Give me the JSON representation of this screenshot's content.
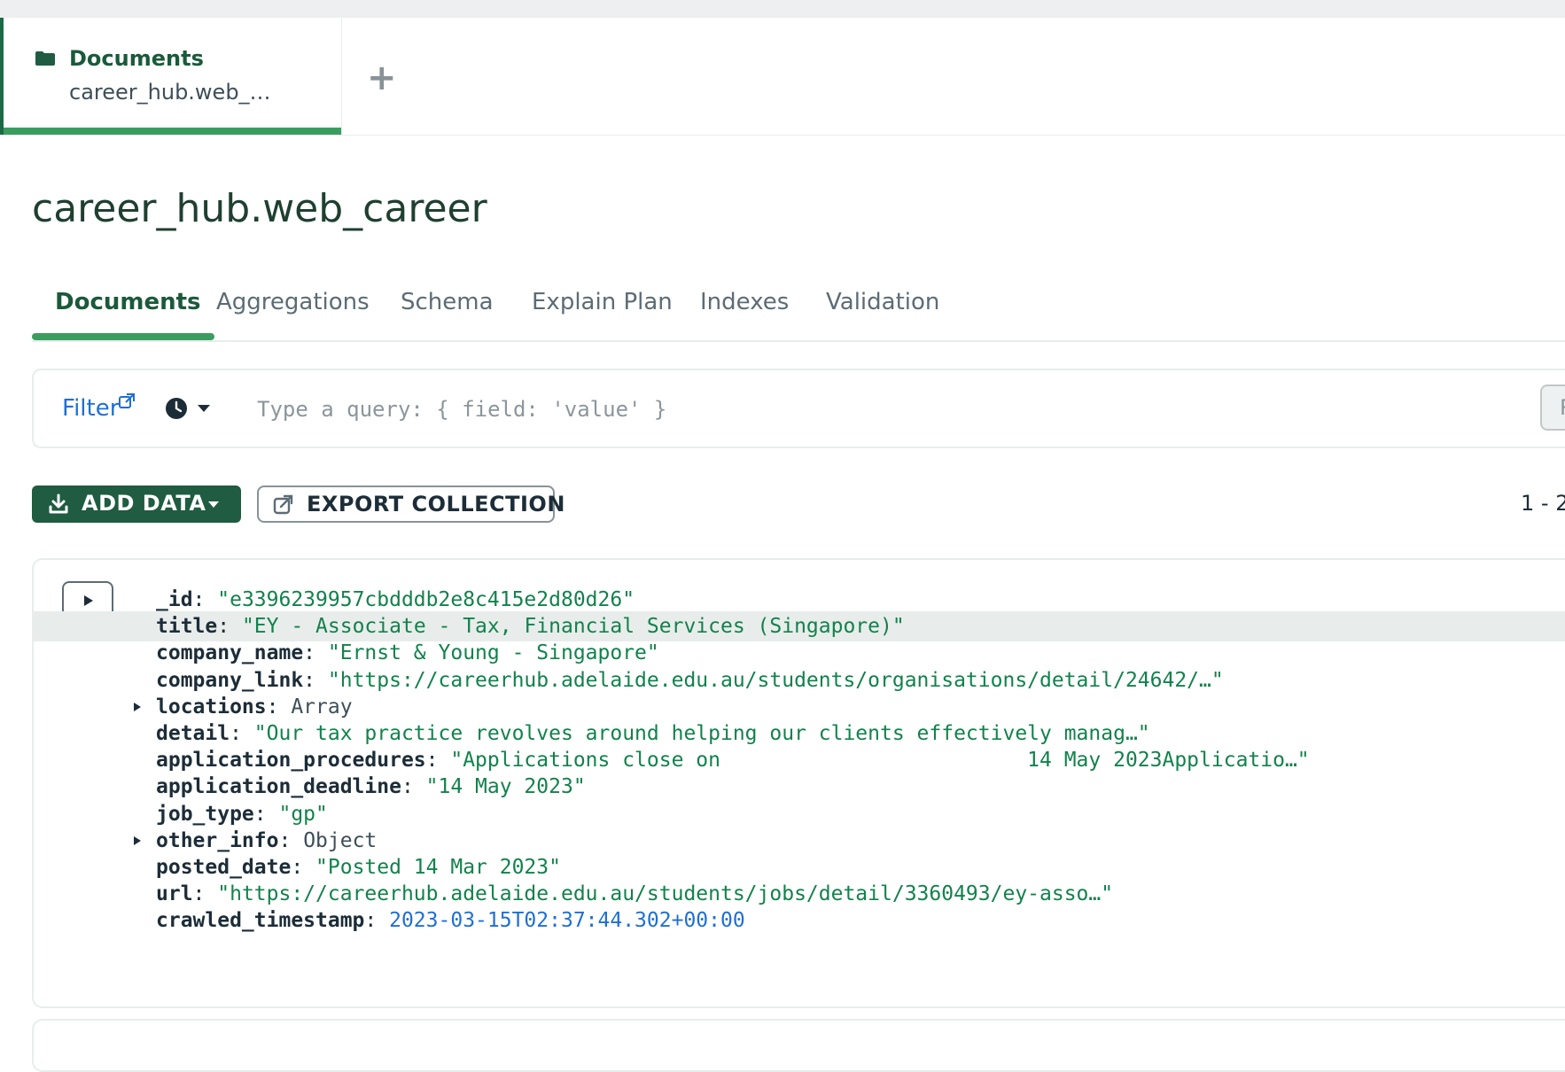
{
  "tab": {
    "title": "Documents",
    "subtitle": "career_hub.web_…",
    "add": "+"
  },
  "collection_title": "career_hub.web_career",
  "subtabs": [
    "Documents",
    "Aggregations",
    "Schema",
    "Explain Plan",
    "Indexes",
    "Validation"
  ],
  "filter": {
    "label": "Filter",
    "placeholder": "Type a query: { field: 'value' }",
    "reset_label": "Re"
  },
  "toolbar": {
    "add_data": "ADD DATA",
    "export": "EXPORT COLLECTION",
    "pagination": "1 - 2"
  },
  "document": {
    "fields": [
      {
        "key": "_id",
        "value": "\"e3396239957cbdddb2e8c415e2d80d26\"",
        "kind": "string"
      },
      {
        "key": "title",
        "value": "\"EY - Associate - Tax, Financial Services (Singapore)\"",
        "kind": "string"
      },
      {
        "key": "company_name",
        "value": "\"Ernst & Young - Singapore\"",
        "kind": "string"
      },
      {
        "key": "company_link",
        "value": "\"https://careerhub.adelaide.edu.au/students/organisations/detail/24642/…\"",
        "kind": "string"
      },
      {
        "key": "locations",
        "value": "Array",
        "kind": "type"
      },
      {
        "key": "detail",
        "value": "\"Our tax practice revolves around helping our clients effectively manag…\"",
        "kind": "string"
      },
      {
        "key": "application_procedures",
        "value": "\"Applications close on                         14 May 2023Applicatio…\"",
        "kind": "string"
      },
      {
        "key": "application_deadline",
        "value": "\"14 May 2023\"",
        "kind": "string"
      },
      {
        "key": "job_type",
        "value": "\"gp\"",
        "kind": "string"
      },
      {
        "key": "other_info",
        "value": "Object",
        "kind": "type"
      },
      {
        "key": "posted_date",
        "value": "\"Posted 14 Mar 2023\"",
        "kind": "string"
      },
      {
        "key": "url",
        "value": "\"https://careerhub.adelaide.edu.au/students/jobs/detail/3360493/ey-asso…\"",
        "kind": "string"
      },
      {
        "key": "crawled_timestamp",
        "value": "2023-03-15T02:37:44.302+00:00",
        "kind": "date"
      }
    ]
  },
  "colors": {
    "accent": "#3a9d5f",
    "brand_dark": "#1f5c41",
    "link": "#1f6fd4",
    "string": "#12824c"
  },
  "icons": {
    "tab": "folder-icon",
    "filter_link": "external-link-icon",
    "history": "history-icon",
    "add_data": "download-icon",
    "export": "export-icon",
    "expand": "play-icon"
  }
}
